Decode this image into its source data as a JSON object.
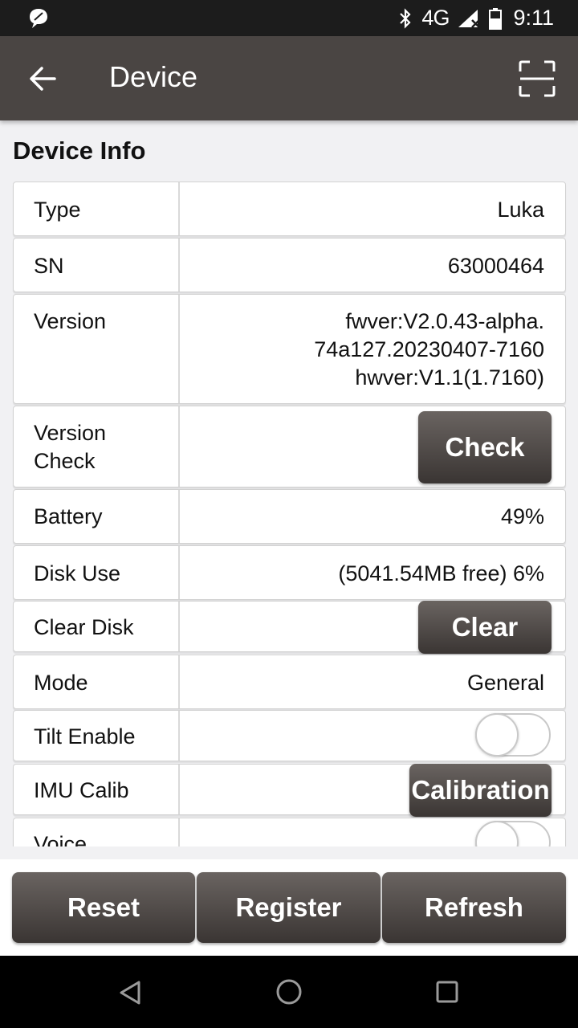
{
  "status_bar": {
    "network": "4G",
    "time": "9:11"
  },
  "app_bar": {
    "title": "Device"
  },
  "section": {
    "title": "Device Info"
  },
  "rows": {
    "type": {
      "label": "Type",
      "value": "Luka"
    },
    "sn": {
      "label": "SN",
      "value": "63000464"
    },
    "version": {
      "label": "Version",
      "value_lines": [
        "fwver:V2.0.43-alpha.",
        "74a127.20230407-7160",
        "hwver:V1.1(1.7160)"
      ]
    },
    "version_check": {
      "label_lines": [
        "Version",
        "Check"
      ],
      "button": "Check"
    },
    "battery": {
      "label": "Battery",
      "value": "49%"
    },
    "disk_use": {
      "label": "Disk Use",
      "value": "(5041.54MB free) 6%"
    },
    "clear_disk": {
      "label": "Clear Disk",
      "button": "Clear"
    },
    "mode": {
      "label": "Mode",
      "value": "General"
    },
    "tilt_enable": {
      "label": "Tilt Enable",
      "enabled": false
    },
    "imu_calib": {
      "label": "IMU Calib",
      "button": "Calibration"
    },
    "voice": {
      "label": "Voice",
      "enabled": false
    }
  },
  "bottom_buttons": {
    "reset": "Reset",
    "register": "Register",
    "refresh": "Refresh"
  },
  "colors": {
    "app_bar": "#4a4543",
    "button_dark": "#4a4543",
    "status_bar": "#1c1c1c"
  }
}
